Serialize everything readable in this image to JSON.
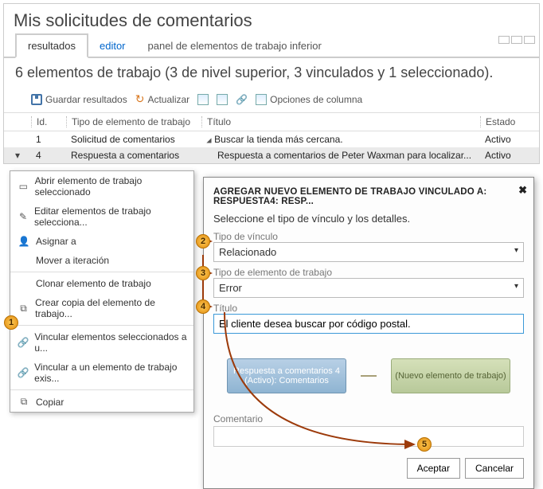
{
  "header": {
    "title": "Mis solicitudes de comentarios"
  },
  "tabs": {
    "results": "resultados",
    "editor": "editor",
    "panel": "panel de elementos de trabajo inferior"
  },
  "summary": "6 elementos de trabajo (3 de nivel superior, 3 vinculados y 1 seleccionado).",
  "toolbar": {
    "save": "Guardar resultados",
    "refresh": "Actualizar",
    "columns": "Opciones de columna"
  },
  "grid": {
    "headers": {
      "id": "Id.",
      "type": "Tipo de elemento de trabajo",
      "title": "Título",
      "state": "Estado"
    },
    "rows": [
      {
        "id": "1",
        "type": "Solicitud de comentarios",
        "title": "Buscar la tienda más cercana.",
        "state": "Activo"
      },
      {
        "id": "4",
        "type": "Respuesta a comentarios",
        "title": "Respuesta a comentarios de Peter Waxman para localizar...",
        "state": "Activo"
      }
    ]
  },
  "ctxmenu": {
    "open": "Abrir elemento de trabajo seleccionado",
    "edit": "Editar elementos de trabajo selecciona...",
    "assign": "Asignar a",
    "move": "Mover a iteración",
    "clone": "Clonar elemento de trabajo",
    "copy_new": "Crear copia del elemento de trabajo...",
    "link_sel": "Vincular elementos seleccionados a u...",
    "link_exist": "Vincular a un elemento de trabajo exis...",
    "copy": "Copiar"
  },
  "dialog": {
    "title": "AGREGAR NUEVO ELEMENTO DE TRABAJO VINCULADO A: RESPUESTA4: RESP...",
    "subtitle": "Seleccione el tipo de vínculo y los detalles.",
    "link_type_label": "Tipo de vínculo",
    "link_type_value": "Relacionado",
    "wit_label": "Tipo de elemento de trabajo",
    "wit_value": "Error",
    "title_label": "Título",
    "title_value": "El cliente desea buscar por código postal.",
    "rel_left": "Respuesta a comentarios 4 (Activo): Comentarios",
    "rel_right": "(Nuevo elemento de trabajo)",
    "comment_label": "Comentario",
    "ok": "Aceptar",
    "cancel": "Cancelar"
  },
  "badges": {
    "b1": "1",
    "b2": "2",
    "b3": "3",
    "b4": "4",
    "b5": "5"
  }
}
